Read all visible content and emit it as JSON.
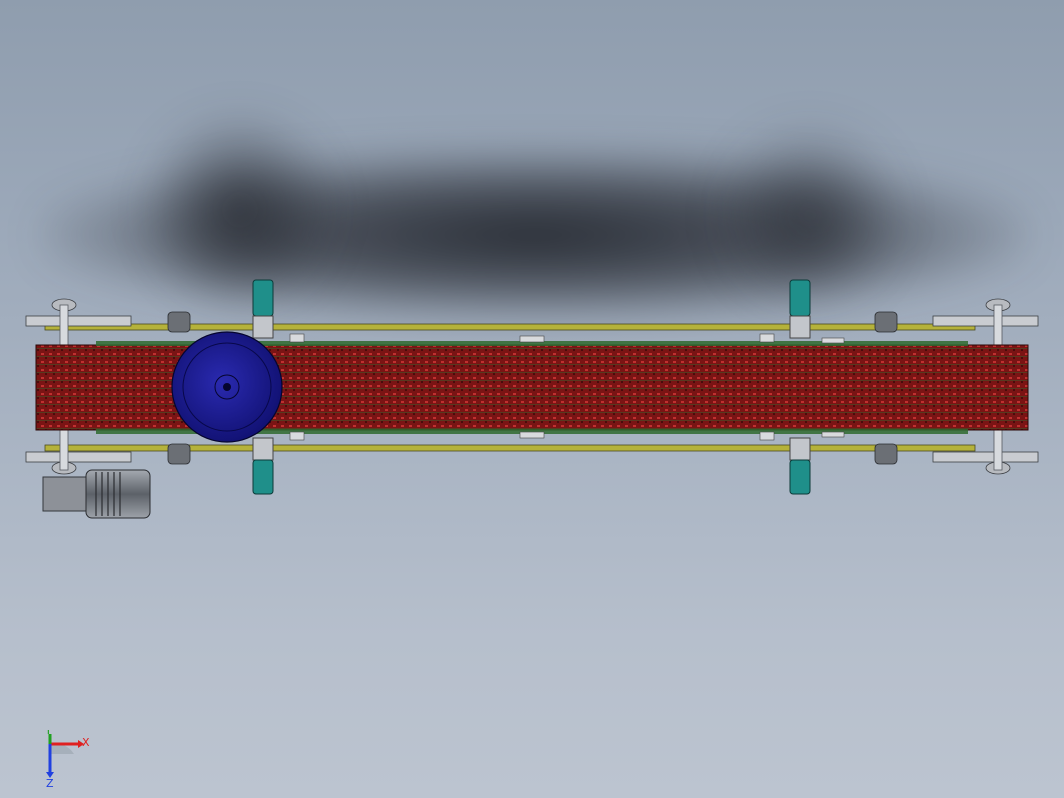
{
  "viewport": {
    "background_top": "#8f9dae",
    "background_bottom": "#bcc4d0"
  },
  "model": {
    "belt_color": "#8b1a1a",
    "frame_color": "#b5b23a",
    "motor_disk_color": "#1a1a8c",
    "bearing_color": "#1f8f8a",
    "motor_color": "#7a7f86"
  },
  "triad": {
    "x_label": "X",
    "y_label": "Y",
    "z_label": "Z",
    "x_color": "#e02020",
    "y_color": "#20a020",
    "z_color": "#2040e0"
  }
}
